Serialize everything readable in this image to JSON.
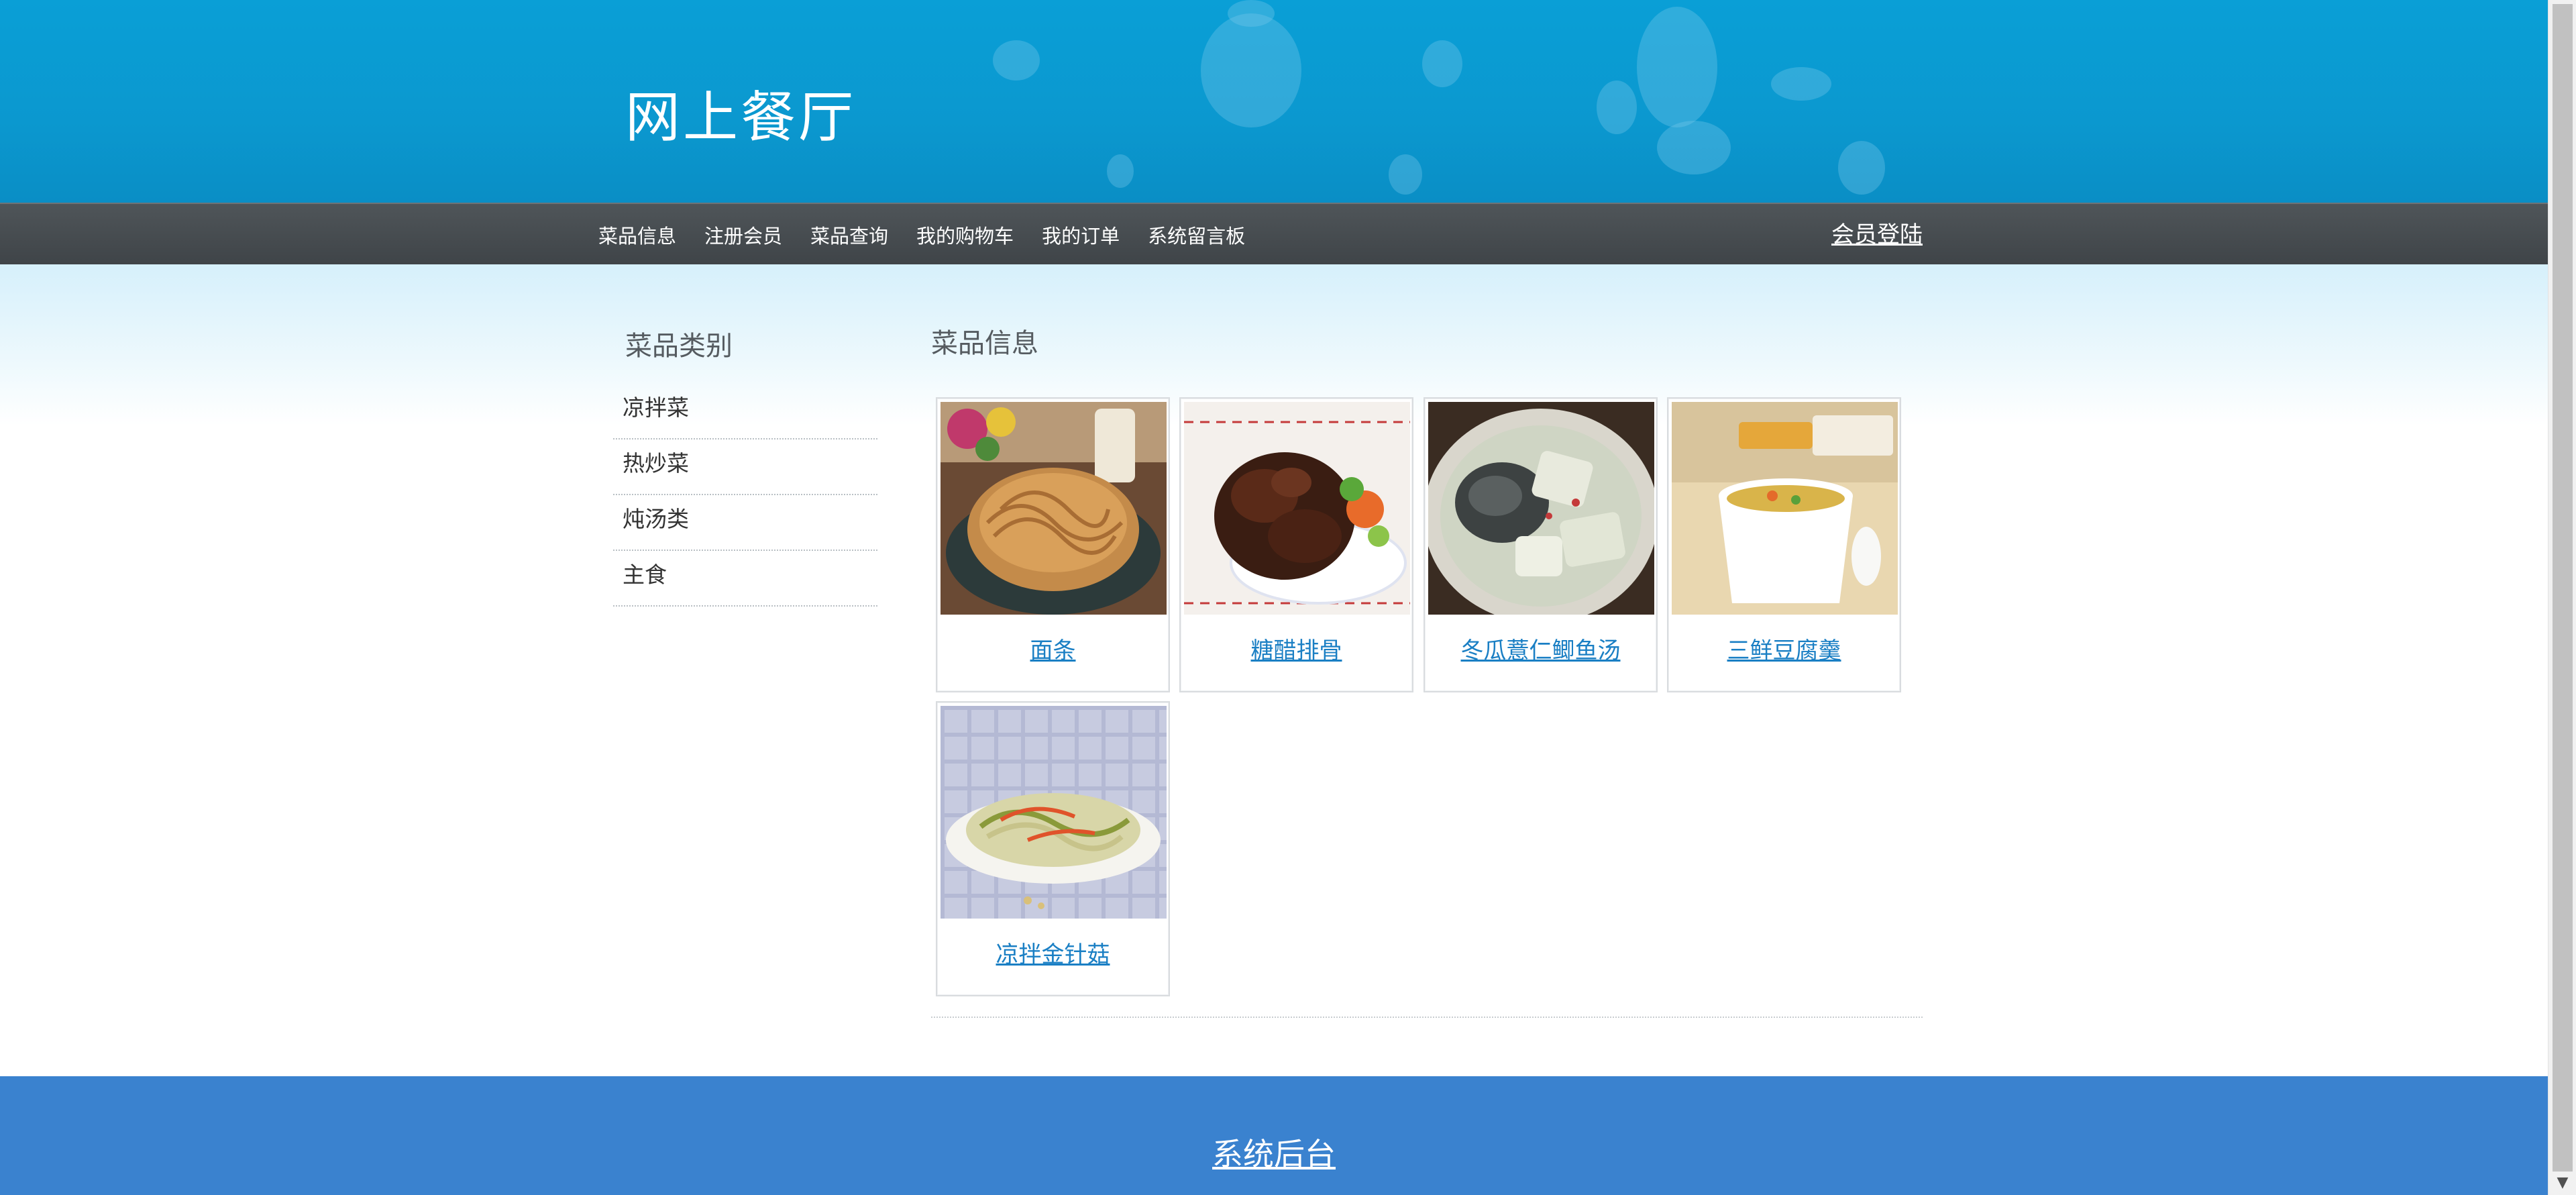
{
  "site": {
    "title": "网上餐厅"
  },
  "nav": {
    "items": [
      {
        "label": "菜品信息"
      },
      {
        "label": "注册会员"
      },
      {
        "label": "菜品查询"
      },
      {
        "label": "我的购物车"
      },
      {
        "label": "我的订单"
      },
      {
        "label": "系统留言板"
      }
    ],
    "login_label": "会员登陆"
  },
  "sidebar": {
    "title": "菜品类别",
    "categories": [
      {
        "label": "凉拌菜"
      },
      {
        "label": "热炒菜"
      },
      {
        "label": "炖汤类"
      },
      {
        "label": "主食"
      }
    ]
  },
  "main": {
    "title": "菜品信息",
    "dishes": [
      {
        "name": "面条",
        "photo": "noodles-photo"
      },
      {
        "name": "糖醋排骨",
        "photo": "sweet-sour-ribs-photo"
      },
      {
        "name": "冬瓜薏仁鲫鱼汤",
        "photo": "fish-soup-photo"
      },
      {
        "name": "三鲜豆腐羹",
        "photo": "tofu-soup-photo"
      },
      {
        "name": "凉拌金针菇",
        "photo": "enoki-salad-photo"
      }
    ]
  },
  "footer": {
    "admin_label": "系统后台"
  },
  "colors": {
    "header_blue": "#0a9fd6",
    "nav_gray": "#474c50",
    "link_blue": "#1a7fc4",
    "footer_blue": "#3a82cf"
  }
}
